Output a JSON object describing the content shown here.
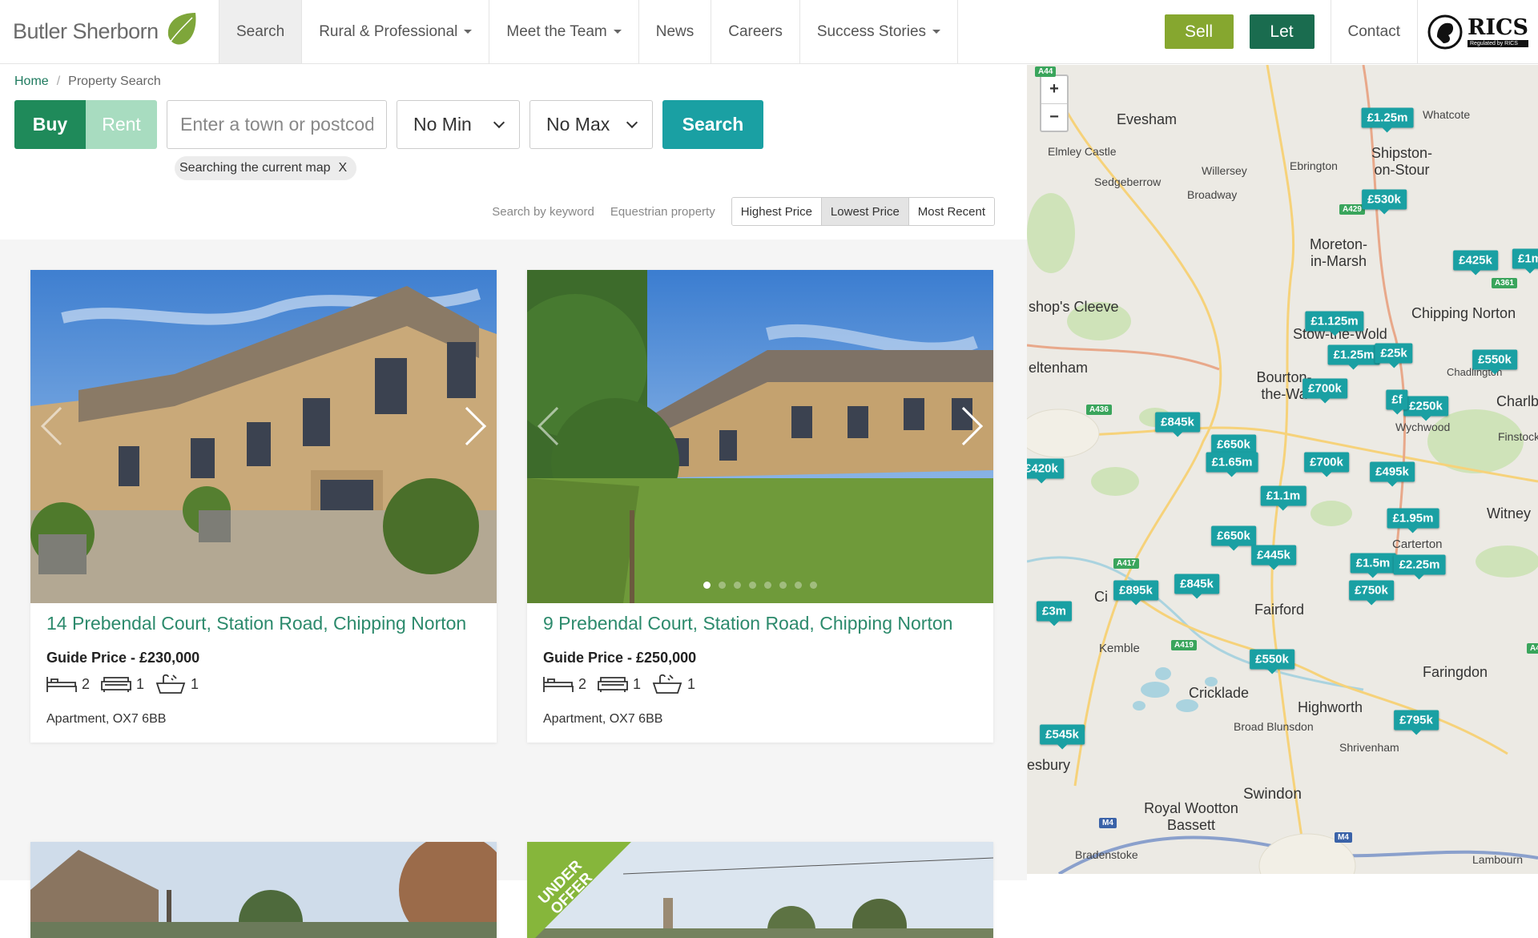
{
  "header": {
    "logo_text": "Butler Sherborn",
    "nav": [
      {
        "label": "Search",
        "dropdown": false
      },
      {
        "label": "Rural & Professional",
        "dropdown": true
      },
      {
        "label": "Meet the Team",
        "dropdown": true
      },
      {
        "label": "News",
        "dropdown": false
      },
      {
        "label": "Careers",
        "dropdown": false
      },
      {
        "label": "Success Stories",
        "dropdown": true
      }
    ],
    "sell_label": "Sell",
    "let_label": "Let",
    "contact_label": "Contact",
    "rics_label": "RICS",
    "rics_sub": "Regulated by RICS"
  },
  "breadcrumb": {
    "home": "Home",
    "sep": "/",
    "current": "Property Search"
  },
  "search": {
    "buy_label": "Buy",
    "rent_label": "Rent",
    "town_placeholder": "Enter a town or postcode",
    "min_value": "No Min",
    "max_value": "No Max",
    "button_label": "Search",
    "chip_label": "Searching the current map",
    "chip_close": "X"
  },
  "filters": {
    "keyword": "Search by keyword",
    "equestrian": "Equestrian property",
    "sort": [
      "Highest Price",
      "Lowest Price",
      "Most Recent"
    ],
    "active_sort": "Lowest Price"
  },
  "cards": [
    {
      "title": "14 Prebendal Court, Station Road, Chipping Norton",
      "price": "Guide Price - £230,000",
      "beds": "2",
      "receptions": "1",
      "baths": "1",
      "type": "Apartment, OX7 6BB"
    },
    {
      "title": "9 Prebendal Court, Station Road, Chipping Norton",
      "price": "Guide Price - £250,000",
      "beds": "2",
      "receptions": "1",
      "baths": "1",
      "type": "Apartment, OX7 6BB"
    }
  ],
  "under_offer_label": "UNDER OFFER",
  "map": {
    "zoom_in": "+",
    "zoom_out": "−",
    "places": [
      "Evesham",
      "Whatcote",
      "Elmley Castle",
      "Shipston-on-Stour",
      "Sedgeberrow",
      "Willersey",
      "Ebrington",
      "Broadway",
      "Moreton-in-Marsh",
      "shop's Cleeve",
      "Chipping Norton",
      "eltenham",
      "Bourton-the-Wa",
      "Charlbury",
      "Finstock",
      "Wychwood",
      "Witney",
      "Carterton",
      "Fairford",
      "Kemble",
      "Faringdon",
      "Cricklade",
      "Highworth",
      "Broad Blunsdon",
      "Shrivenham",
      "esbury",
      "Swindon",
      "Royal Wootton Bassett",
      "Bradenstoke",
      "Lambourn",
      "Chadlington",
      "Stow-the-Wold",
      "Ci"
    ],
    "pins": [
      "£1.25m",
      "£530k",
      "£425k",
      "£1m",
      "£1.125m",
      "£1.25m",
      "£25k",
      "£550k",
      "£700k",
      "£250k",
      "£845k",
      "£650k",
      "£1.65m",
      "£700k",
      "£420k",
      "£495k",
      "£1.1m",
      "£1.95m",
      "£650k",
      "£445k",
      "£1.5m",
      "£2.25m",
      "£895k",
      "£845k",
      "£750k",
      "£3m",
      "£550k",
      "£795k",
      "£545k",
      "£f"
    ],
    "roads": [
      "A44",
      "A429",
      "A361",
      "A436",
      "A417",
      "A419",
      "M4",
      "M4",
      "A4"
    ]
  }
}
